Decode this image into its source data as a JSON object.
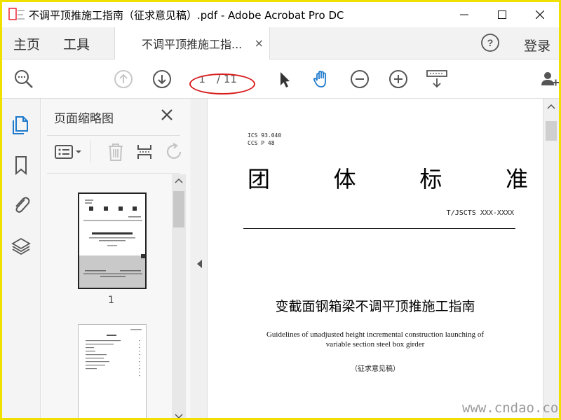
{
  "window": {
    "title": "不调平顶推施工指南（征求意见稿）.pdf - Adobe Acrobat Pro DC"
  },
  "tabs": {
    "home": "主页",
    "tools": "工具",
    "document_tab": "不调平顶推施工指...",
    "document_tab_close": "×",
    "login": "登录"
  },
  "toolbar": {
    "current_page": "1",
    "total_pages": "/ 11"
  },
  "thumbnails_panel": {
    "title": "页面缩略图",
    "page_labels": [
      "1"
    ]
  },
  "document": {
    "ics": "ICS 93.040",
    "ccs": "CCS P 48",
    "heading_chars": [
      "团",
      "体",
      "标",
      "准"
    ],
    "standard_code": "T/JSCTS XXX-XXXX",
    "title_cn": "变截面钢箱梁不调平顶推施工指南",
    "title_en_line1": "Guidelines of unadjusted height incremental construction launching of",
    "title_en_line2": "variable section steel box girder",
    "draft_note": "（征求意见稿）"
  },
  "watermark": "www.cndao.com",
  "colors": {
    "accent_blue": "#1f7acc",
    "highlight_red": "#d81e1e",
    "frame_yellow": "#f0e000"
  }
}
